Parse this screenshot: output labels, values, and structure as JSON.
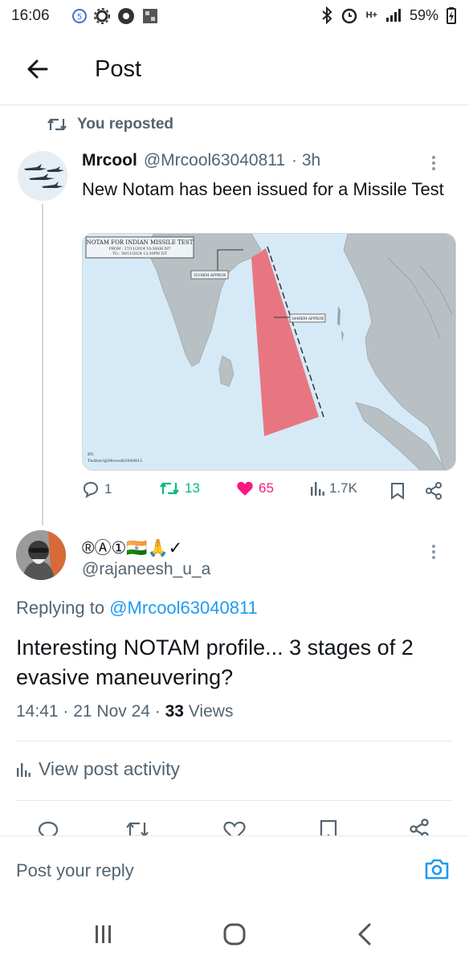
{
  "status": {
    "time": "16:06",
    "net": "H+",
    "battery": "59%"
  },
  "header": {
    "title": "Post"
  },
  "repost": {
    "label": "You reposted"
  },
  "tweet1": {
    "name": "Mrcool",
    "handle": "@Mrcool63040811",
    "time": "· 3h",
    "text": "New Notam has been issued for a Missile Test",
    "media": {
      "title": "NOTAM FOR INDIAN MISSILE TEST",
      "from": "FROM : 27/11/2024 10:30AM IST",
      "to": "TO : 30/11/2024 12:30PM IST",
      "label_left": "3510KM APPROX",
      "label_right": "3440KM APPROX",
      "credit1": "BY:",
      "credit2": "Twitter/@Mrcool63040811"
    },
    "replies": "1",
    "reposts": "13",
    "likes": "65",
    "views": "1.7K",
    "colors": {
      "repost": "#00ba7c",
      "like": "#f91880"
    }
  },
  "tweet2": {
    "name": "®Ⓐ①🇮🇳🙏✓",
    "handle": "@rajaneesh_u_a",
    "replying_prefix": "Replying to",
    "replying_to": "@Mrcool63040811",
    "text": "Interesting NOTAM profile... 3 stages of 2 evasive maneuvering?",
    "time": "14:41 · 21 Nov 24 · ",
    "views_count": "33",
    "views_label": " Views",
    "activity": "View post activity"
  },
  "composer": {
    "placeholder": "Post your reply"
  },
  "accent": "#1d9bf0"
}
